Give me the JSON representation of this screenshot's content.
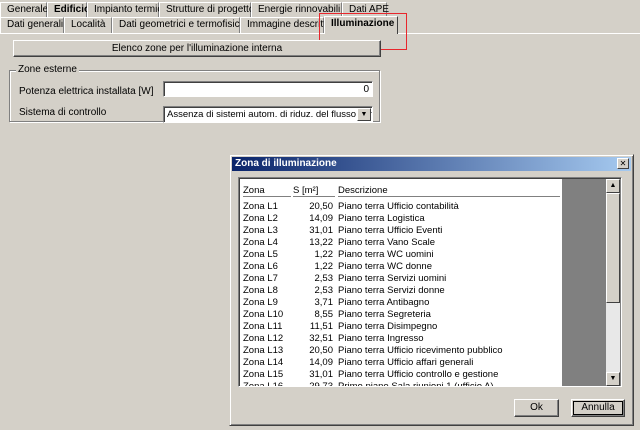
{
  "main_tabs": [
    "Generale",
    "Edificio",
    "Impianto termico",
    "Strutture di progetto",
    "Energie rinnovabili",
    "Dati APE"
  ],
  "sub_tabs": [
    "Dati generali",
    "Località",
    "Dati geometrici e termofisici",
    "Immagine descrittiva",
    "Illuminazione"
  ],
  "zones_button": "Elenco zone per l'illuminazione interna",
  "group": {
    "title": "Zone esterne",
    "power_label": "Potenza elettrica installata [W]",
    "power_value": "0",
    "control_label": "Sistema di controllo",
    "control_value": "Assenza di sistemi autom. di riduz. del flusso luminoso"
  },
  "dialog": {
    "title": "Zona di illuminazione",
    "columns": [
      "Zona",
      "S [m²]",
      "Descrizione"
    ],
    "rows": [
      [
        "Zona L1",
        "20,50",
        "Piano terra Ufficio contabilità"
      ],
      [
        "Zona L2",
        "14,09",
        "Piano terra Logistica"
      ],
      [
        "Zona L3",
        "31,01",
        "Piano terra Ufficio Eventi"
      ],
      [
        "Zona L4",
        "13,22",
        "Piano terra Vano Scale"
      ],
      [
        "Zona L5",
        "1,22",
        "Piano terra WC uomini"
      ],
      [
        "Zona L6",
        "1,22",
        "Piano terra WC donne"
      ],
      [
        "Zona L7",
        "2,53",
        "Piano terra Servizi uomini"
      ],
      [
        "Zona L8",
        "2,53",
        "Piano terra Servizi donne"
      ],
      [
        "Zona L9",
        "3,71",
        "Piano terra Antibagno"
      ],
      [
        "Zona L10",
        "8,55",
        "Piano terra Segreteria"
      ],
      [
        "Zona L11",
        "11,51",
        "Piano terra Disimpegno"
      ],
      [
        "Zona L12",
        "32,51",
        "Piano terra Ingresso"
      ],
      [
        "Zona L13",
        "20,50",
        "Piano terra Ufficio ricevimento pubblico"
      ],
      [
        "Zona L14",
        "14,09",
        "Piano terra Ufficio affari generali"
      ],
      [
        "Zona L15",
        "31,01",
        "Piano terra Ufficio controllo e gestione"
      ],
      [
        "Zona L16",
        "29,73",
        "Primo piano Sala riunioni 1 (ufficio A)"
      ]
    ],
    "ok_label": "Ok",
    "cancel_label": "Annulla"
  },
  "colors": {
    "highlight": "#e8262c",
    "titlebar": "#0a246a"
  },
  "icons": {
    "close": "close-icon",
    "dropdown": "chevron-down-icon",
    "scroll_up": "arrow-up-icon",
    "scroll_down": "arrow-down-icon"
  }
}
